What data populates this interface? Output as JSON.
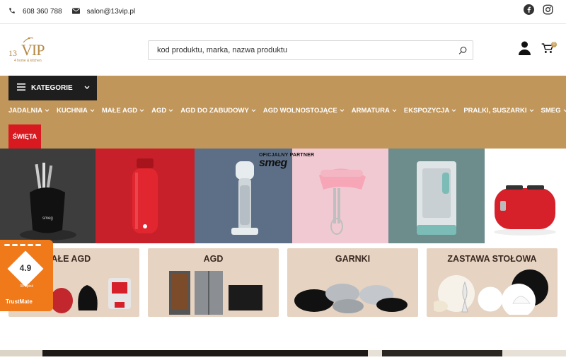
{
  "topbar": {
    "phone": "608 360 788",
    "email": "salon@13vip.pl"
  },
  "logo": {
    "number": "13",
    "text": "VIP",
    "tagline": "4 home & kitchen"
  },
  "search": {
    "placeholder": "kod produktu, marka, nazwa produktu"
  },
  "cart": {
    "count": "0"
  },
  "nav": {
    "categories_label": "KATEGORIE",
    "items": [
      {
        "label": "JADALNIA"
      },
      {
        "label": "KUCHNIA"
      },
      {
        "label": "MAŁE AGD"
      },
      {
        "label": "AGD"
      },
      {
        "label": "AGD DO ZABUDOWY"
      },
      {
        "label": "AGD WOLNOSTOJĄCE"
      },
      {
        "label": "ARMATURA"
      },
      {
        "label": "EKSPOZYCJA"
      },
      {
        "label": "PRALKI, SUSZARKI"
      },
      {
        "label": "SMEG"
      }
    ],
    "special": "ŚWIĘTA"
  },
  "hero": {
    "partner_text": "OFICJALNY PARTNER",
    "partner_brand": "smeg",
    "panels": [
      {
        "color": "#3d3d3d"
      },
      {
        "color": "#c8202a"
      },
      {
        "color": "#5d6f86"
      },
      {
        "color": "#f0c9d2"
      },
      {
        "color": "#6d8c8c"
      },
      {
        "color": "#ffffff"
      }
    ]
  },
  "categories": [
    {
      "title": "MAŁE AGD"
    },
    {
      "title": "AGD"
    },
    {
      "title": "GARNKI"
    },
    {
      "title": "ZASTAWA STOŁOWA"
    }
  ],
  "trustmate": {
    "score": "4.9",
    "reviews": "30 opinii",
    "brand": "TrustMate"
  },
  "colors": {
    "accent": "#c1965a",
    "dark": "#1e1e1e",
    "red": "#d8191f",
    "trust_orange": "#f07a1a",
    "card_bg": "#e6d3c2"
  }
}
